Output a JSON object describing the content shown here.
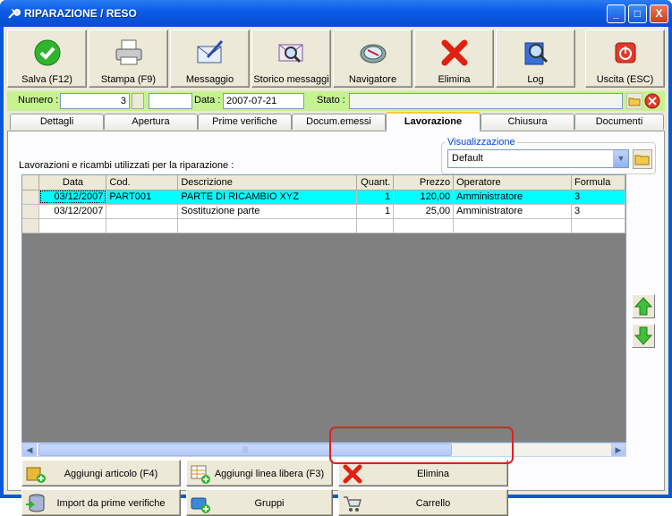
{
  "window": {
    "title": "RIPARAZIONE / RESO",
    "min": "_",
    "max": "□",
    "close": "X"
  },
  "toolbar": [
    {
      "label": "Salva (F12)",
      "icon": "check-icon"
    },
    {
      "label": "Stampa (F9)",
      "icon": "printer-icon"
    },
    {
      "label": "Messaggio",
      "icon": "envelope-pen-icon"
    },
    {
      "label": "Storico messaggi",
      "icon": "envelope-search-icon"
    },
    {
      "label": "Navigatore",
      "icon": "compass-icon"
    },
    {
      "label": "Elimina",
      "icon": "red-x-icon"
    },
    {
      "label": "Log",
      "icon": "book-search-icon"
    },
    {
      "label": "Uscita (ESC)",
      "icon": "power-icon"
    }
  ],
  "header_fields": {
    "numero_label": "Numero :",
    "numero_value": "3",
    "data_label": "Data :",
    "data_value": "2007-07-21",
    "stato_label": "Stato :",
    "stato_value": ""
  },
  "tabs": [
    "Dettagli",
    "Apertura",
    "Prime verifiche",
    "Docum.emessi",
    "Lavorazione",
    "Chiusura",
    "Documenti"
  ],
  "active_tab": "Lavorazione",
  "visualizzazione": {
    "legend": "Visualizzazione",
    "selected": "Default"
  },
  "caption": "Lavorazioni e ricambi utilizzati per la riparazione :",
  "grid": {
    "columns": [
      "Data",
      "Cod.",
      "Descrizione",
      "Quant.",
      "Prezzo",
      "Operatore",
      "Formula"
    ],
    "rows": [
      [
        "03/12/2007",
        "PART001",
        "PARTE DI RICAMBIO XYZ",
        "1",
        "120,00",
        "Amministratore",
        "3"
      ],
      [
        "03/12/2007",
        "",
        "Sostituzione parte",
        "1",
        "25,00",
        "Amministratore",
        "3"
      ],
      [
        "",
        "",
        "",
        "",
        "",
        "",
        ""
      ]
    ]
  },
  "scroll": {
    "grip": "|||"
  },
  "actions": {
    "aggiungi_articolo": "Aggiungi articolo (F4)",
    "aggiungi_linea": "Aggiungi linea libera (F3)",
    "elimina": "Elimina",
    "import_prime": "Import da prime verifiche",
    "gruppi": "Gruppi",
    "carrello": "Carrello"
  },
  "colors": {
    "titlebar": "#0a58d8",
    "numrow": "#c6f28f",
    "selected_row": "#00ffff",
    "highlight": "#e02020"
  }
}
